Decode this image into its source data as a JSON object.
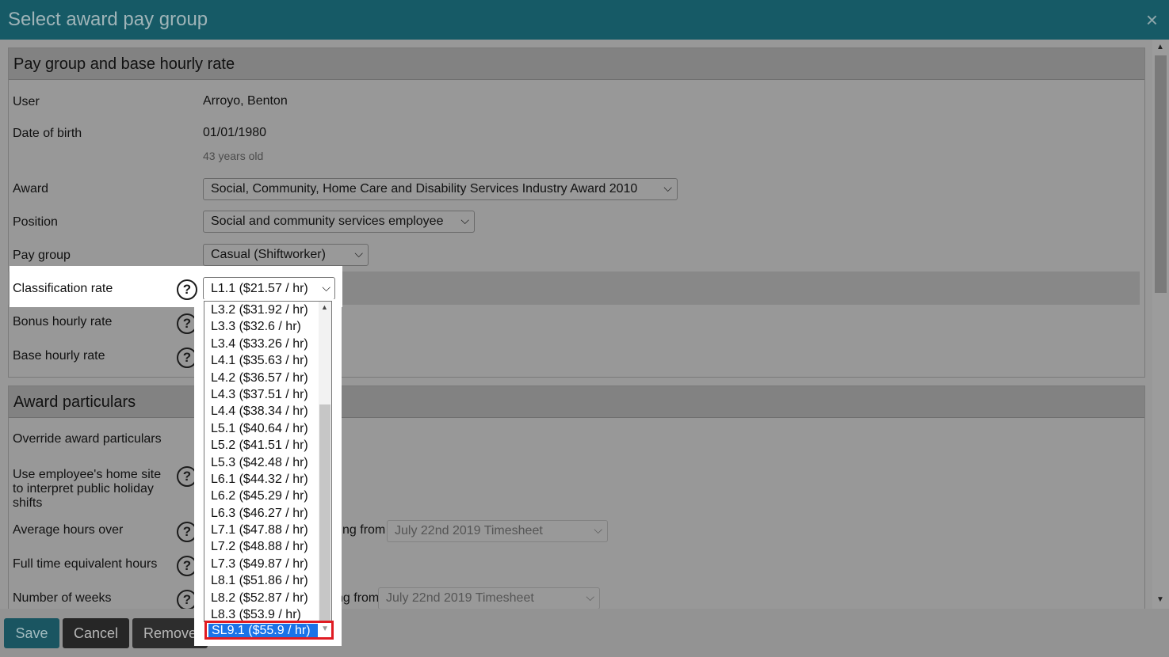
{
  "dialog": {
    "title": "Select award pay group",
    "close_icon": "×"
  },
  "section1": {
    "title": "Pay group and base hourly rate",
    "user_label": "User",
    "user_value": "Arroyo, Benton",
    "dob_label": "Date of birth",
    "dob_value": "01/01/1980",
    "age_text": "43 years old",
    "award_label": "Award",
    "award_value": "Social, Community, Home Care and Disability Services Industry Award 2010",
    "position_label": "Position",
    "position_value": "Social and community services employee",
    "paygroup_label": "Pay group",
    "paygroup_value": "Casual (Shiftworker)",
    "classification_label": "Classification rate",
    "classification_value": "L1.1 ($21.57 / hr)",
    "bonus_label": "Bonus hourly rate",
    "base_label": "Base hourly rate"
  },
  "section2": {
    "title": "Award particulars",
    "override_label": "Override award particulars",
    "home_site_label": "Use employee's home site to interpret public holiday shifts",
    "avg_hours_label": "Average hours over",
    "avg_starting_text": "ting from",
    "avg_timesheet_value": "July 22nd 2019 Timesheet",
    "fte_label": "Full time equivalent hours",
    "weeks_label": "Number of weeks",
    "weeks_starting_text": "ng from",
    "weeks_timesheet_value": "July 22nd 2019 Timesheet"
  },
  "dropdown": {
    "options": [
      "L3.2 ($31.92 / hr)",
      "L3.3 ($32.6 / hr)",
      "L3.4 ($33.26 / hr)",
      "L4.1 ($35.63 / hr)",
      "L4.2 ($36.57 / hr)",
      "L4.3 ($37.51 / hr)",
      "L4.4 ($38.34 / hr)",
      "L5.1 ($40.64 / hr)",
      "L5.2 ($41.51 / hr)",
      "L5.3 ($42.48 / hr)",
      "L6.1 ($44.32 / hr)",
      "L6.2 ($45.29 / hr)",
      "L6.3 ($46.27 / hr)",
      "L7.1 ($47.88 / hr)",
      "L7.2 ($48.88 / hr)",
      "L7.3 ($49.87 / hr)",
      "L8.1 ($51.86 / hr)",
      "L8.2 ($52.87 / hr)",
      "L8.3 ($53.9 / hr)"
    ],
    "highlighted": "SL9.1 ($55.9 / hr)"
  },
  "buttons": {
    "save": "Save",
    "cancel": "Cancel",
    "remove": "Remove"
  },
  "colors": {
    "header": "#165a66",
    "highlight": "#1a73e8",
    "outline": "#e01b22"
  }
}
